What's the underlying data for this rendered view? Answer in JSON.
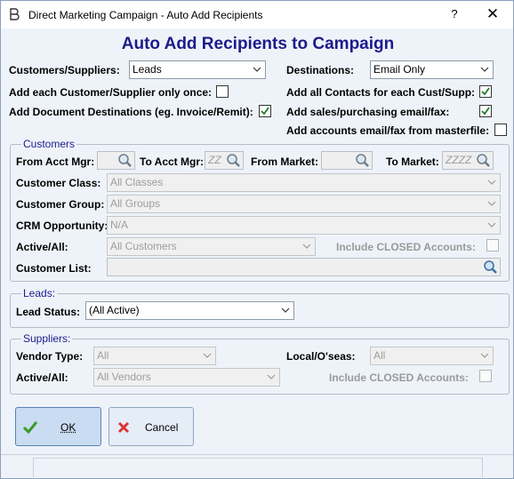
{
  "window": {
    "title": "Direct Marketing Campaign - Auto Add Recipients",
    "help_glyph": "?",
    "close_glyph": "✕"
  },
  "heading": "Auto Add Recipients to Campaign",
  "top": {
    "customers_suppliers_label": "Customers/Suppliers:",
    "customers_suppliers_value": "Leads",
    "destinations_label": "Destinations:",
    "destinations_value": "Email Only",
    "add_once_label": "Add each Customer/Supplier only once:",
    "add_once_checked": false,
    "add_contacts_label": "Add all Contacts for each Cust/Supp:",
    "add_contacts_checked": true,
    "add_doc_dest_label": "Add Document Destinations (eg. Invoice/Remit):",
    "add_doc_dest_checked": true,
    "add_sales_label": "Add sales/purchasing email/fax:",
    "add_sales_checked": true,
    "add_accounts_label": "Add accounts email/fax from masterfile:",
    "add_accounts_checked": false
  },
  "customers": {
    "group_title": "Customers",
    "from_acct_mgr_label": "From Acct Mgr:",
    "from_acct_mgr_value": "",
    "to_acct_mgr_label": "To Acct Mgr:",
    "to_acct_mgr_value": "ZZ",
    "from_market_label": "From Market:",
    "from_market_value": "",
    "to_market_label": "To Market:",
    "to_market_value": "ZZZZ",
    "class_label": "Customer Class:",
    "class_value": "All Classes",
    "group_label": "Customer Group:",
    "group_value": "All Groups",
    "crm_label": "CRM Opportunity:",
    "crm_value": "N/A",
    "active_label": "Active/All:",
    "active_value": "All Customers",
    "include_closed_label": "Include CLOSED Accounts:",
    "include_closed_checked": false,
    "list_label": "Customer List:",
    "list_value": ""
  },
  "leads": {
    "group_title": "Leads:",
    "status_label": "Lead Status:",
    "status_value": "(All Active)"
  },
  "suppliers": {
    "group_title": "Suppliers:",
    "vendor_type_label": "Vendor Type:",
    "vendor_type_value": "All",
    "local_label": "Local/O'seas:",
    "local_value": "All",
    "active_label": "Active/All:",
    "active_value": "All Vendors",
    "include_closed_label": "Include CLOSED Accounts:",
    "include_closed_checked": false
  },
  "buttons": {
    "ok_label": "OK",
    "cancel_label": "Cancel"
  }
}
